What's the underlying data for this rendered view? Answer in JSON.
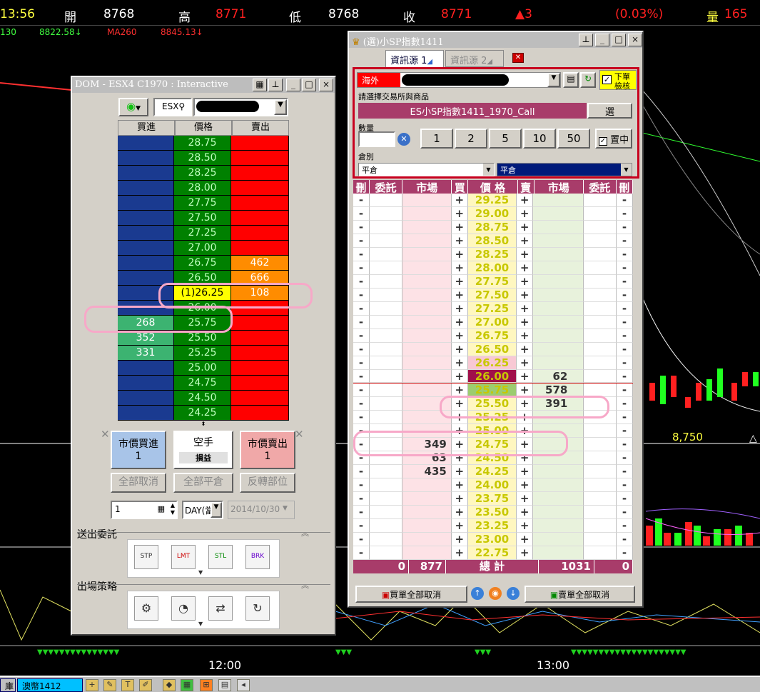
{
  "quote": {
    "time": "13:56",
    "open_label": "開",
    "open": "8768",
    "high_label": "高",
    "high": "8771",
    "low_label": "低",
    "low": "8768",
    "close_label": "收",
    "close": "8771",
    "change": "▲3",
    "pct": "(0.03%)",
    "vol_label": "量",
    "vol": "165"
  },
  "ma": {
    "a": "130",
    "b": "8822.58↓",
    "c": "MA260",
    "d": "8845.13↓"
  },
  "chart": {
    "price_mark": "8,750",
    "times": [
      "12:00",
      "13:00"
    ]
  },
  "taskbar": {
    "tab1": "澳幣1412",
    "left": "庫"
  },
  "dom": {
    "title": "DOM - ESX4 C1970 : Interactive",
    "symbol": "ESX",
    "headers": [
      "買進",
      "價格",
      "賣出"
    ],
    "rows": [
      {
        "bid": "",
        "price": "28.75",
        "ask": ""
      },
      {
        "bid": "",
        "price": "28.50",
        "ask": ""
      },
      {
        "bid": "",
        "price": "28.25",
        "ask": ""
      },
      {
        "bid": "",
        "price": "28.00",
        "ask": ""
      },
      {
        "bid": "",
        "price": "27.75",
        "ask": ""
      },
      {
        "bid": "",
        "price": "27.50",
        "ask": ""
      },
      {
        "bid": "",
        "price": "27.25",
        "ask": ""
      },
      {
        "bid": "",
        "price": "27.00",
        "ask": ""
      },
      {
        "bid": "",
        "price": "26.75",
        "ask": "462"
      },
      {
        "bid": "",
        "price": "26.50",
        "ask": "666"
      },
      {
        "bid": "",
        "price": "(1)26.25",
        "ask": "108"
      },
      {
        "bid": "",
        "price": "26.00",
        "ask": ""
      },
      {
        "bid": "268",
        "price": "25.75",
        "ask": ""
      },
      {
        "bid": "352",
        "price": "25.50",
        "ask": ""
      },
      {
        "bid": "331",
        "price": "25.25",
        "ask": ""
      },
      {
        "bid": "",
        "price": "25.00",
        "ask": ""
      },
      {
        "bid": "",
        "price": "24.75",
        "ask": ""
      },
      {
        "bid": "",
        "price": "24.50",
        "ask": ""
      },
      {
        "bid": "",
        "price": "24.25",
        "ask": ""
      }
    ],
    "mkt_buy": "市價買進",
    "mkt_buy_qty": "1",
    "flat": "空手",
    "pnl": "損益",
    "mkt_sell": "市價賣出",
    "mkt_sell_qty": "1",
    "cancel_all": "全部取消",
    "close_all": "全部平倉",
    "reverse": "反轉部位",
    "qty": "1",
    "tif": "DAY(當",
    "date": "2014/10/30",
    "send_label": "送出委託",
    "exit_label": "出場策略",
    "order_types": [
      "STP",
      "LMT",
      "STL",
      "BRK"
    ]
  },
  "sp": {
    "title": "(選)小SP指數1411",
    "tab1": "資訊源 1",
    "tab2": "資訊源 2",
    "market": "海外",
    "check_label_1": "下單",
    "check_label_2": "檢核",
    "select_label": "請選擇交易所與商品",
    "product": "ES小SP指數1411_1970_Call",
    "choose": "選",
    "qty_label": "數量",
    "qty_buttons": [
      "1",
      "2",
      "5",
      "10",
      "50"
    ],
    "center_label": "置中",
    "pos_label": "倉別",
    "pos1": "平倉",
    "pos2": "平倉",
    "headers": [
      "刪",
      "委託",
      "市場",
      "買",
      "價 格",
      "賣",
      "市場",
      "委託",
      "刪"
    ],
    "rows": [
      {
        "bm": "",
        "p": "29.25",
        "sm": ""
      },
      {
        "bm": "",
        "p": "29.00",
        "sm": ""
      },
      {
        "bm": "",
        "p": "28.75",
        "sm": ""
      },
      {
        "bm": "",
        "p": "28.50",
        "sm": ""
      },
      {
        "bm": "",
        "p": "28.25",
        "sm": ""
      },
      {
        "bm": "",
        "p": "28.00",
        "sm": ""
      },
      {
        "bm": "",
        "p": "27.75",
        "sm": ""
      },
      {
        "bm": "",
        "p": "27.50",
        "sm": ""
      },
      {
        "bm": "",
        "p": "27.25",
        "sm": ""
      },
      {
        "bm": "",
        "p": "27.00",
        "sm": ""
      },
      {
        "bm": "",
        "p": "26.75",
        "sm": ""
      },
      {
        "bm": "",
        "p": "26.50",
        "sm": ""
      },
      {
        "bm": "",
        "p": "26.25",
        "sm": ""
      },
      {
        "bm": "",
        "p": "26.00",
        "sm": "62"
      },
      {
        "bm": "",
        "p": "25.75",
        "sm": "578"
      },
      {
        "bm": "",
        "p": "25.50",
        "sm": "391"
      },
      {
        "bm": "",
        "p": "25.25",
        "sm": ""
      },
      {
        "bm": "",
        "p": "25.00",
        "sm": ""
      },
      {
        "bm": "349",
        "p": "24.75",
        "sm": ""
      },
      {
        "bm": "63",
        "p": "24.50",
        "sm": ""
      },
      {
        "bm": "435",
        "p": "24.25",
        "sm": ""
      },
      {
        "bm": "",
        "p": "24.00",
        "sm": ""
      },
      {
        "bm": "",
        "p": "23.75",
        "sm": ""
      },
      {
        "bm": "",
        "p": "23.50",
        "sm": ""
      },
      {
        "bm": "",
        "p": "23.25",
        "sm": ""
      },
      {
        "bm": "",
        "p": "23.00",
        "sm": ""
      },
      {
        "bm": "",
        "p": "22.75",
        "sm": ""
      }
    ],
    "foot": {
      "bo": "0",
      "bm": "877",
      "label": "總 計",
      "sm": "1031",
      "so": "0"
    },
    "buy_cancel": "買單全部取消",
    "sell_cancel": "賣單全部取消"
  }
}
